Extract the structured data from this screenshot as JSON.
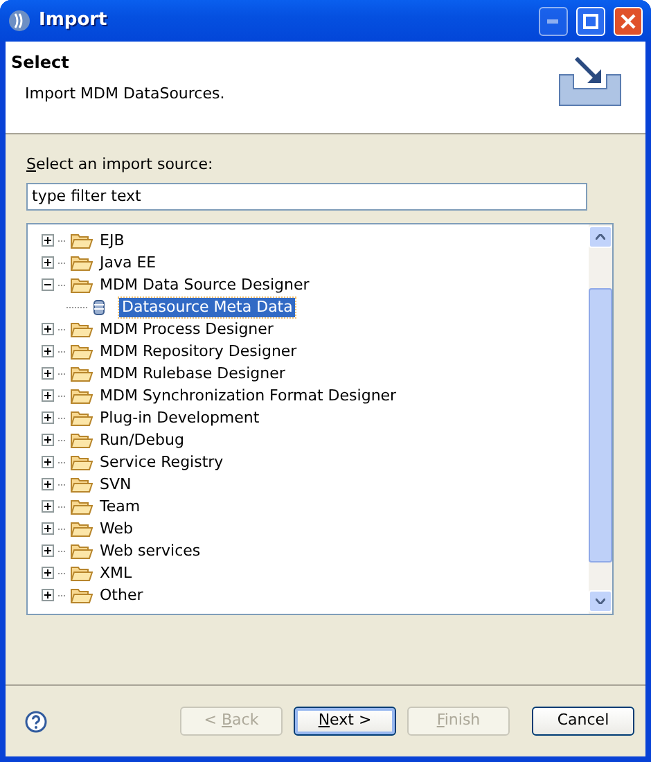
{
  "window": {
    "title": "Import"
  },
  "header": {
    "title": "Select",
    "description": "Import MDM DataSources."
  },
  "source_label": {
    "mnemonic": "S",
    "text_after": "elect an import source:"
  },
  "filter": {
    "placeholder": "type filter text"
  },
  "tree": [
    {
      "label": "EJB",
      "kind": "folder",
      "expanded": false
    },
    {
      "label": "Java EE",
      "kind": "folder",
      "expanded": false
    },
    {
      "label": "MDM Data Source Designer",
      "kind": "folder",
      "expanded": true,
      "children": [
        {
          "label": "Datasource Meta Data",
          "kind": "leaf",
          "selected": true
        }
      ]
    },
    {
      "label": "MDM Process Designer",
      "kind": "folder",
      "expanded": false
    },
    {
      "label": "MDM Repository Designer",
      "kind": "folder",
      "expanded": false
    },
    {
      "label": "MDM Rulebase Designer",
      "kind": "folder",
      "expanded": false
    },
    {
      "label": "MDM Synchronization Format Designer",
      "kind": "folder",
      "expanded": false
    },
    {
      "label": "Plug-in Development",
      "kind": "folder",
      "expanded": false
    },
    {
      "label": "Run/Debug",
      "kind": "folder",
      "expanded": false
    },
    {
      "label": "Service Registry",
      "kind": "folder",
      "expanded": false
    },
    {
      "label": "SVN",
      "kind": "folder",
      "expanded": false
    },
    {
      "label": "Team",
      "kind": "folder",
      "expanded": false
    },
    {
      "label": "Web",
      "kind": "folder",
      "expanded": false
    },
    {
      "label": "Web services",
      "kind": "folder",
      "expanded": false
    },
    {
      "label": "XML",
      "kind": "folder",
      "expanded": false
    },
    {
      "label": "Other",
      "kind": "folder",
      "expanded": false
    }
  ],
  "buttons": [
    {
      "text_before": "< ",
      "mnemonic": "B",
      "text_after": "ack",
      "disabled": true,
      "default": false
    },
    {
      "mnemonic": "N",
      "text_after": "ext >",
      "disabled": false,
      "default": true
    },
    {
      "mnemonic": "F",
      "text_after": "inish",
      "disabled": true,
      "default": false
    },
    {
      "text_after": "Cancel",
      "disabled": false,
      "default": false
    }
  ]
}
